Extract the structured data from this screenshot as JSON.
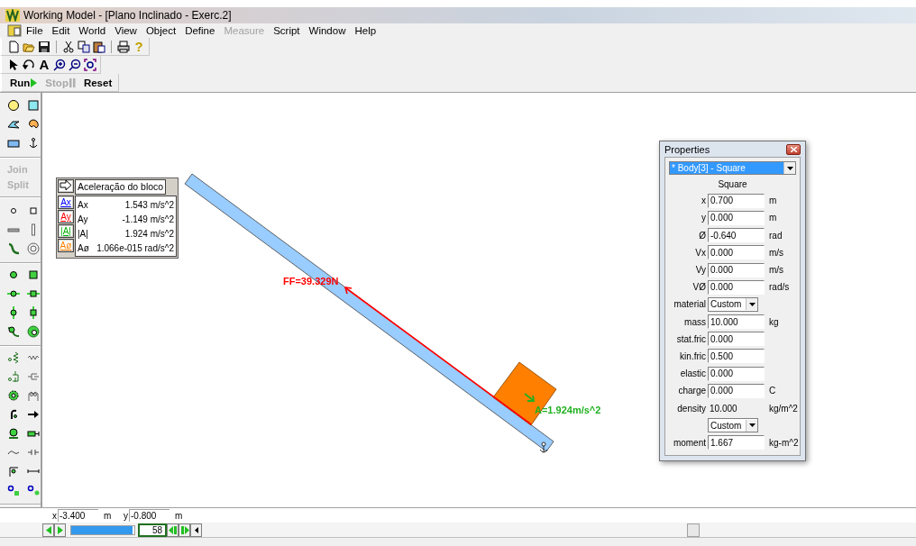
{
  "window": {
    "title": "Working Model - [Plano Inclinado - Exerc.2]"
  },
  "menu": [
    {
      "label": "File",
      "disabled": false
    },
    {
      "label": "Edit",
      "disabled": false
    },
    {
      "label": "World",
      "disabled": false
    },
    {
      "label": "View",
      "disabled": false
    },
    {
      "label": "Object",
      "disabled": false
    },
    {
      "label": "Define",
      "disabled": false
    },
    {
      "label": "Measure",
      "disabled": true
    },
    {
      "label": "Script",
      "disabled": false
    },
    {
      "label": "Window",
      "disabled": false
    },
    {
      "label": "Help",
      "disabled": false
    }
  ],
  "toolbar": {
    "text_tool": "A",
    "help": "?"
  },
  "run_controls": [
    {
      "kind": "run",
      "label": "Run",
      "disabled": false
    },
    {
      "kind": "stop",
      "label": "Stop",
      "disabled": true
    },
    {
      "kind": "reset",
      "label": "Reset",
      "disabled": false
    }
  ],
  "tool_palette": [
    {
      "label": "Join",
      "disabled": true
    },
    {
      "label": "Split",
      "disabled": true
    }
  ],
  "meter": {
    "title": "Aceleração do bloco",
    "rows": [
      {
        "button": "Ax",
        "label": "Ax",
        "value": "1.543 m/s^2",
        "color": "#0000ff"
      },
      {
        "button": "Ay",
        "label": "Ay",
        "value": "-1.149 m/s^2",
        "color": "#ff0000"
      },
      {
        "button": "|A|",
        "label": "|A|",
        "value": "1.924 m/s^2",
        "color": "#00b000"
      },
      {
        "button": "Aø",
        "label": "Aø",
        "value": "1.066e-015 rad/s^2",
        "color": "#ff8000"
      }
    ]
  },
  "canvas": {
    "force_label": "FF=39.329N",
    "accel_label": "A=1.924m/s^2"
  },
  "properties": {
    "title": "Properties",
    "object": "* Body[3] - Square",
    "shape": "Square",
    "rows": [
      {
        "kind": "field",
        "label": "x",
        "value": "0.700",
        "unit": "m"
      },
      {
        "kind": "field",
        "label": "y",
        "value": "0.000",
        "unit": "m"
      },
      {
        "kind": "field",
        "label": "Ø",
        "value": "-0.640",
        "unit": "rad"
      },
      {
        "kind": "field",
        "label": "Vx",
        "value": "0.000",
        "unit": "m/s"
      },
      {
        "kind": "field",
        "label": "Vy",
        "value": "0.000",
        "unit": "m/s"
      },
      {
        "kind": "field",
        "label": "VØ",
        "value": "0.000",
        "unit": "rad/s"
      },
      {
        "kind": "select",
        "label": "material",
        "value": "Custom"
      },
      {
        "kind": "field",
        "label": "mass",
        "value": "10.000",
        "unit": "kg"
      },
      {
        "kind": "field",
        "label": "stat.fric",
        "value": "0.000"
      },
      {
        "kind": "field",
        "label": "kin.fric",
        "value": "0.500"
      },
      {
        "kind": "field",
        "label": "elastic",
        "value": "0.000"
      },
      {
        "kind": "field",
        "label": "charge",
        "value": "0.000",
        "unit": "C"
      },
      {
        "kind": "readonly",
        "label": "density",
        "value": "10.000",
        "unit": "kg/m^2"
      },
      {
        "kind": "select",
        "value": "Custom"
      },
      {
        "kind": "field",
        "label": "moment",
        "value": "1.667",
        "unit": "kg-m^2"
      }
    ]
  },
  "coordinates": [
    {
      "label": "x",
      "value": "-3.400",
      "unit": "m"
    },
    {
      "label": "y",
      "value": "-0.800",
      "unit": "m"
    }
  ],
  "playback": {
    "frame": "58",
    "level": 0.97
  }
}
